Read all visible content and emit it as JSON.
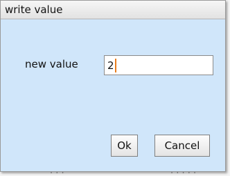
{
  "dialog": {
    "title": "write value",
    "field_label": "new value",
    "input_value": "2",
    "ok_label": "Ok",
    "cancel_label": "Cancel"
  },
  "background": {
    "top_fragment": "· · ·  · · ·",
    "bottom_fragment": "· · ·",
    "bottom_right_fragment": "· · · · ·"
  },
  "colors": {
    "dialog_body": "#d0e6fa",
    "caret": "#e87d1e"
  }
}
